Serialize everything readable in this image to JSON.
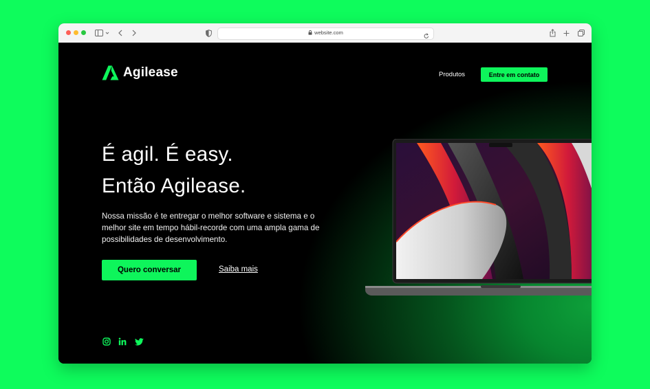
{
  "browser": {
    "url": "website.com"
  },
  "header": {
    "brand": "Agilease",
    "nav_products": "Produtos",
    "nav_contact": "Entre em contato"
  },
  "hero": {
    "headline_line1": "É agil. É easy.",
    "headline_line2": "Então Agilease.",
    "description": "Nossa missão é te entregar o melhor software e sistema e o melhor site em tempo hábil-recorde com uma ampla gama de possibilidades de desenvolvimento.",
    "primary_button": "Quero conversar",
    "secondary_link": "Saiba mais"
  },
  "social": [
    "instagram-icon",
    "linkedin-icon",
    "twitter-icon"
  ],
  "colors": {
    "page_background": "#0efc5c",
    "accent": "#0ef55b",
    "site_background": "#000000"
  }
}
